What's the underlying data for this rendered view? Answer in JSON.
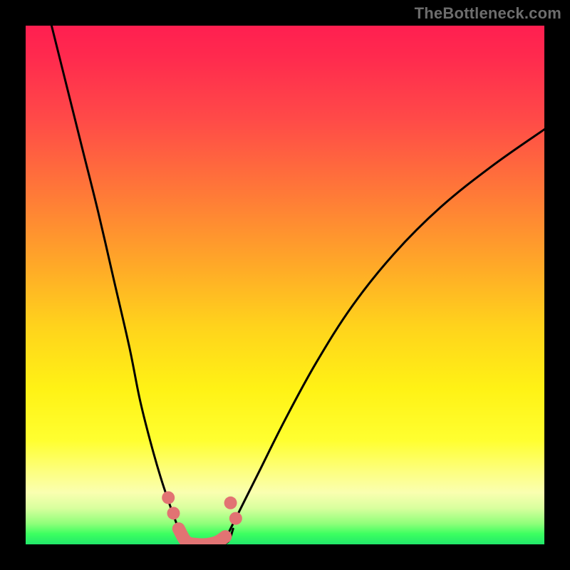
{
  "watermark": "TheBottleneck.com",
  "chart_data": {
    "type": "line",
    "title": "",
    "xlabel": "",
    "ylabel": "",
    "xlim": [
      0,
      100
    ],
    "ylim": [
      0,
      100
    ],
    "series": [
      {
        "name": "bottleneck-curve-left",
        "x": [
          5,
          8,
          11,
          14,
          17,
          20,
          22,
          24,
          26,
          28,
          29.5,
          31
        ],
        "y": [
          100,
          88,
          76,
          64,
          51,
          38,
          28,
          20,
          13,
          7,
          3,
          0
        ]
      },
      {
        "name": "bottleneck-floor",
        "x": [
          29.5,
          31,
          33,
          35,
          37,
          39,
          40
        ],
        "y": [
          3,
          0,
          0,
          0,
          0,
          0.5,
          3
        ]
      },
      {
        "name": "bottleneck-curve-right",
        "x": [
          38,
          41,
          45,
          50,
          56,
          63,
          71,
          80,
          90,
          100
        ],
        "y": [
          0,
          6,
          14,
          24,
          35,
          46,
          56,
          65,
          73,
          80
        ]
      }
    ],
    "markers": {
      "name": "bottleneck-floor-markers",
      "color": "#e27373",
      "points": [
        {
          "x": 27.5,
          "y": 9
        },
        {
          "x": 28.5,
          "y": 6
        },
        {
          "x": 39.5,
          "y": 8
        },
        {
          "x": 40.5,
          "y": 5
        }
      ],
      "segment": {
        "x": [
          29.5,
          31,
          33,
          35,
          37,
          38.5
        ],
        "y": [
          3,
          0.5,
          0,
          0,
          0.5,
          1.5
        ]
      }
    },
    "background_gradient": {
      "top": "#ff1f50",
      "mid": "#fff215",
      "bottom": "#22e86a"
    }
  }
}
